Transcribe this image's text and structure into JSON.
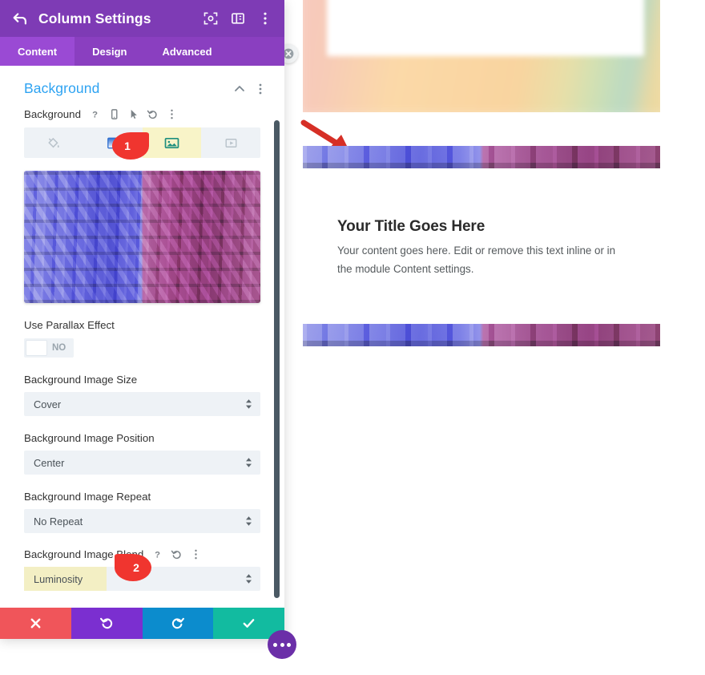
{
  "panel": {
    "title": "Column Settings",
    "back_icon": "back-arrow-icon",
    "header_icons": [
      {
        "name": "expand-view-icon"
      },
      {
        "name": "split-layout-icon"
      },
      {
        "name": "kebab-menu-icon"
      }
    ],
    "tabs": [
      {
        "label": "Content",
        "active": true
      },
      {
        "label": "Design",
        "active": false
      },
      {
        "label": "Advanced",
        "active": false
      }
    ],
    "section": {
      "title": "Background",
      "collapse_icon": "chevron-up-icon",
      "menu_icon": "kebab-menu-icon"
    },
    "background_field": {
      "label": "Background",
      "icons": [
        {
          "name": "help-icon",
          "glyph": "?"
        },
        {
          "name": "responsive-mobile-icon"
        },
        {
          "name": "hover-cursor-icon"
        },
        {
          "name": "reset-undo-icon"
        },
        {
          "name": "kebab-menu-icon"
        }
      ],
      "types": [
        {
          "name": "background-color-tab",
          "icon": "paint-bucket-icon",
          "active": false
        },
        {
          "name": "background-gradient-tab",
          "icon": "gradient-icon",
          "active": false
        },
        {
          "name": "background-image-tab",
          "icon": "image-icon",
          "active": true
        },
        {
          "name": "background-video-tab",
          "icon": "video-icon",
          "active": false
        }
      ]
    },
    "fields": [
      {
        "label": "Use Parallax Effect",
        "type": "toggle",
        "value": "NO"
      },
      {
        "label": "Background Image Size",
        "type": "select",
        "value": "Cover"
      },
      {
        "label": "Background Image Position",
        "type": "select",
        "value": "Center"
      },
      {
        "label": "Background Image Repeat",
        "type": "select",
        "value": "No Repeat"
      }
    ],
    "blend_field": {
      "label": "Background Image Blend",
      "value": "Luminosity",
      "highlighted": true,
      "icons": [
        {
          "name": "help-icon",
          "glyph": "?"
        },
        {
          "name": "reset-undo-icon"
        },
        {
          "name": "kebab-menu-icon"
        }
      ]
    },
    "actions": [
      {
        "name": "cancel-button",
        "icon": "close-x-icon",
        "color": "#f0555a"
      },
      {
        "name": "undo-button",
        "icon": "undo-icon",
        "color": "#7b2fd0"
      },
      {
        "name": "redo-button",
        "icon": "redo-icon",
        "color": "#0c8ccd"
      },
      {
        "name": "save-button",
        "icon": "checkmark-icon",
        "color": "#12bba0"
      }
    ],
    "fab": {
      "name": "more-options-fab",
      "icon": "three-dots-icon"
    },
    "drag_handle": {
      "name": "panel-resize-handle",
      "icon": "resize-icon"
    }
  },
  "preview": {
    "title": "Your Title Goes Here",
    "body": "Your content goes here. Edit or remove this text inline or in the module Content settings."
  },
  "annotations": {
    "markers": [
      {
        "id": "1",
        "label": "1",
        "direction": "right"
      },
      {
        "id": "2",
        "label": "2",
        "direction": "left"
      }
    ],
    "arrow": {
      "name": "red-pointer-arrow",
      "color": "#d62f26"
    }
  },
  "colors": {
    "header_purple": "#7e3bb5",
    "tab_purple": "#8a3fc0",
    "tab_active": "#9a4ad4",
    "section_blue": "#2ea3f2",
    "highlight_yellow": "#f8f4c8",
    "marker_red": "#f0352f"
  }
}
